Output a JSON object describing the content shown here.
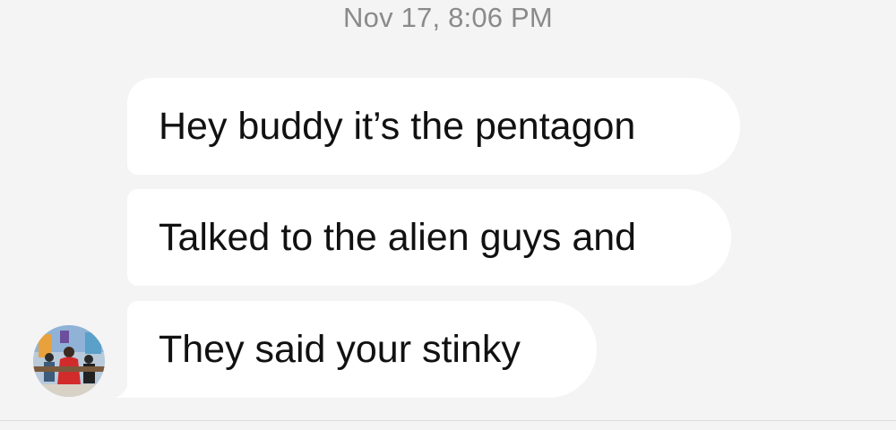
{
  "thread": {
    "timestamp": "Nov 17, 8:06 PM",
    "messages": [
      {
        "text": "Hey buddy it’s the pentagon"
      },
      {
        "text": "Talked to the alien guys and"
      },
      {
        "text": "They said your stinky"
      }
    ],
    "sender_avatar_icon": "contact-avatar-photo"
  },
  "colors": {
    "background": "#f4f4f4",
    "bubble": "#ffffff",
    "message_text": "#111111",
    "timestamp_text": "#8a8a8a"
  }
}
